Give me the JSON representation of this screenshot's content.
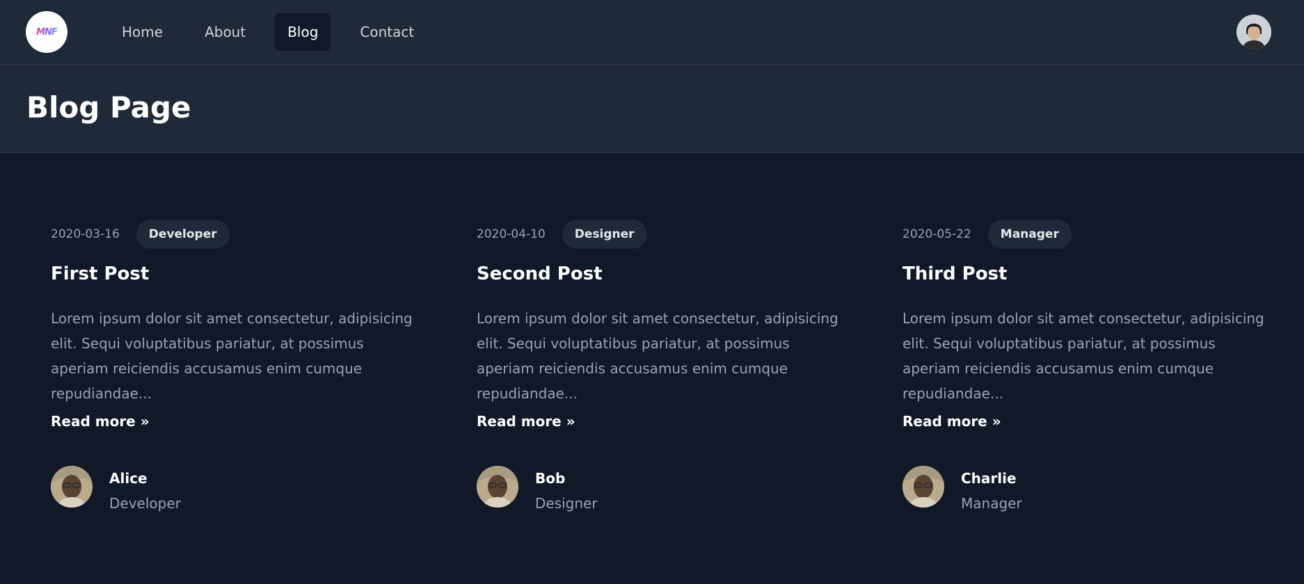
{
  "nav": {
    "logo_text": "MNF",
    "items": [
      {
        "label": "Home",
        "active": false
      },
      {
        "label": "About",
        "active": false
      },
      {
        "label": "Blog",
        "active": true
      },
      {
        "label": "Contact",
        "active": false
      }
    ]
  },
  "header": {
    "title": "Blog Page"
  },
  "posts": [
    {
      "date": "2020-03-16",
      "tag": "Developer",
      "title": "First Post",
      "excerpt": "Lorem ipsum dolor sit amet consectetur, adipisicing elit. Sequi voluptatibus pariatur, at possimus aperiam reiciendis accusamus enim cumque repudiandae...",
      "read_more": "Read more »",
      "author": {
        "name": "Alice",
        "role": "Developer"
      }
    },
    {
      "date": "2020-04-10",
      "tag": "Designer",
      "title": "Second Post",
      "excerpt": "Lorem ipsum dolor sit amet consectetur, adipisicing elit. Sequi voluptatibus pariatur, at possimus aperiam reiciendis accusamus enim cumque repudiandae...",
      "read_more": "Read more »",
      "author": {
        "name": "Bob",
        "role": "Designer"
      }
    },
    {
      "date": "2020-05-22",
      "tag": "Manager",
      "title": "Third Post",
      "excerpt": "Lorem ipsum dolor sit amet consectetur, adipisicing elit. Sequi voluptatibus pariatur, at possimus aperiam reiciendis accusamus enim cumque repudiandae...",
      "read_more": "Read more »",
      "author": {
        "name": "Charlie",
        "role": "Manager"
      }
    }
  ],
  "colors": {
    "background": "#111827",
    "panel": "#1f2937",
    "text_muted": "#9ca3af",
    "text_primary": "#ffffff"
  }
}
